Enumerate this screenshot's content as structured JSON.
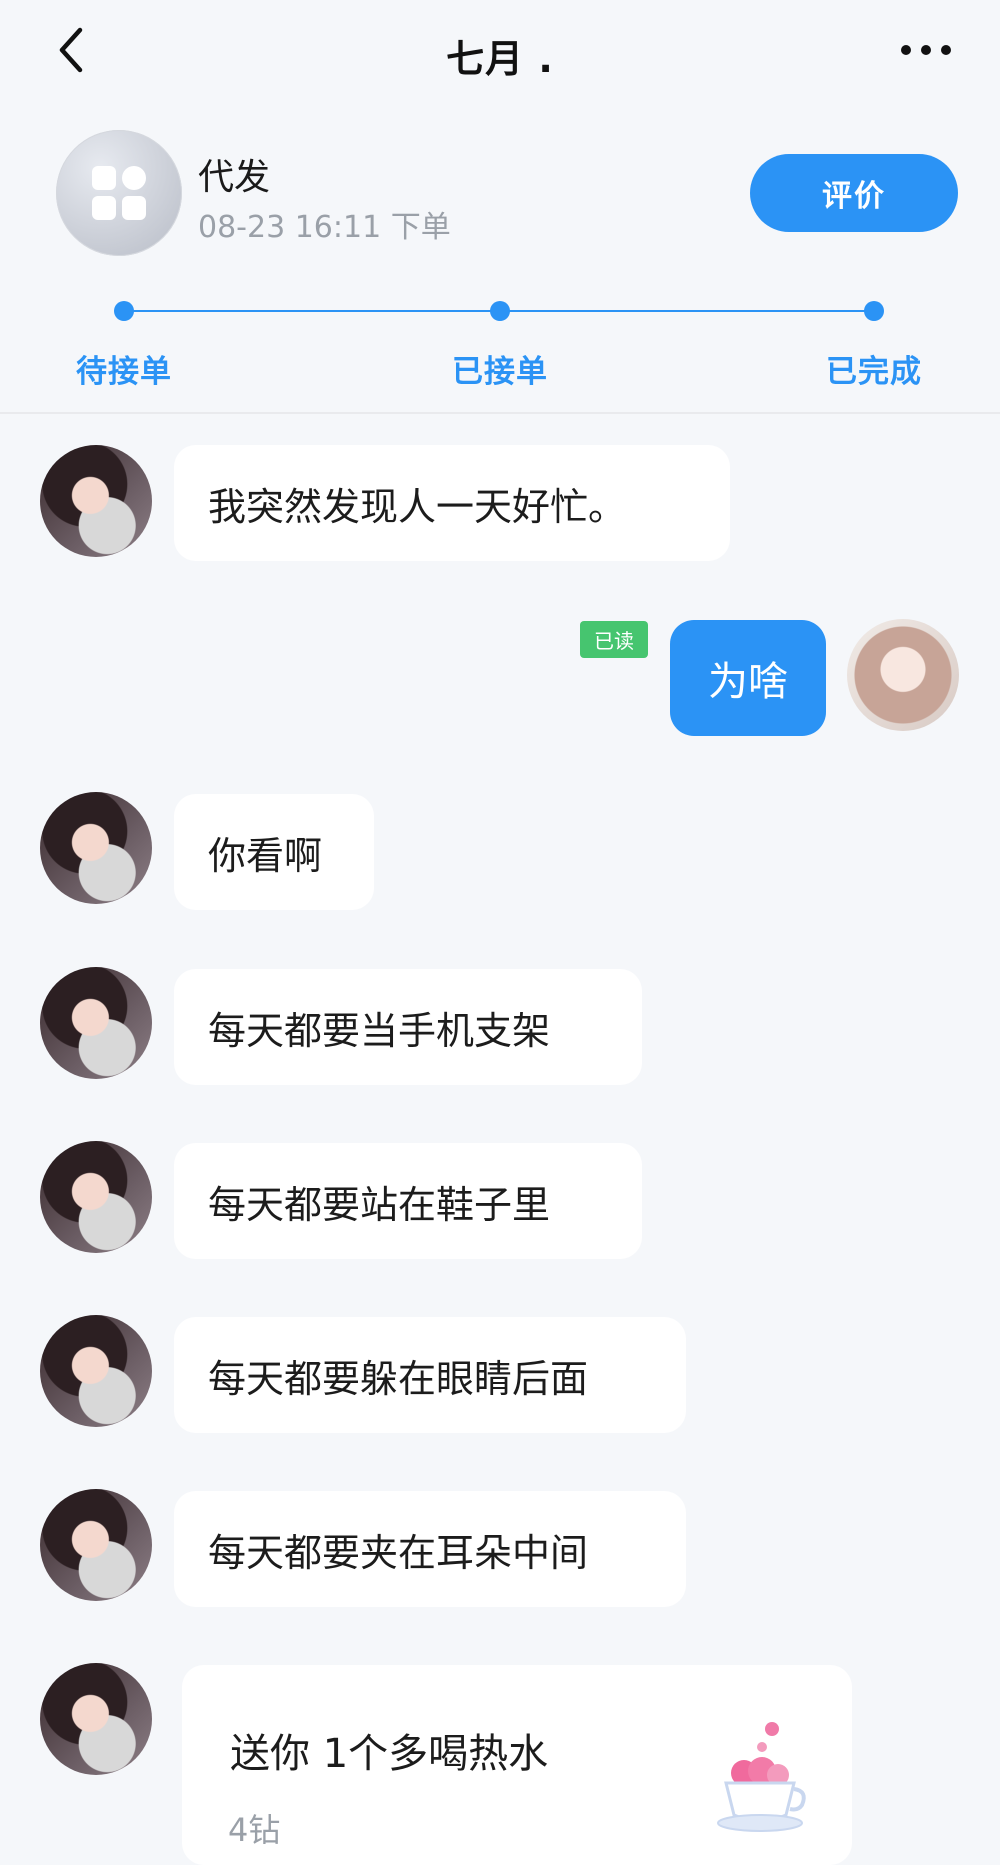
{
  "header": {
    "title": "七月 ."
  },
  "order": {
    "name": "代发",
    "time": "08-23 16:11 下单",
    "rate_label": "评价"
  },
  "progress": {
    "steps": [
      "待接单",
      "已接单",
      "已完成"
    ]
  },
  "messages": {
    "m1": "我突然发现人一天好忙。",
    "m2": "为啥",
    "m2_status": "已读",
    "m3": "你看啊",
    "m4": "每天都要当手机支架",
    "m5": "每天都要站在鞋子里",
    "m6": "每天都要躲在眼睛后面",
    "m7": "每天都要夹在耳朵中间"
  },
  "gift": {
    "text": "送你 1个多喝热水",
    "price": "4钻"
  },
  "colors": {
    "accent": "#2b93f5",
    "read_badge": "#46c56f",
    "background": "#f5f7fa"
  },
  "icons": {
    "back": "chevron-left-icon",
    "more": "more-horizontal-icon",
    "order": "apps-grid-icon",
    "gift": "teacup-icon"
  }
}
